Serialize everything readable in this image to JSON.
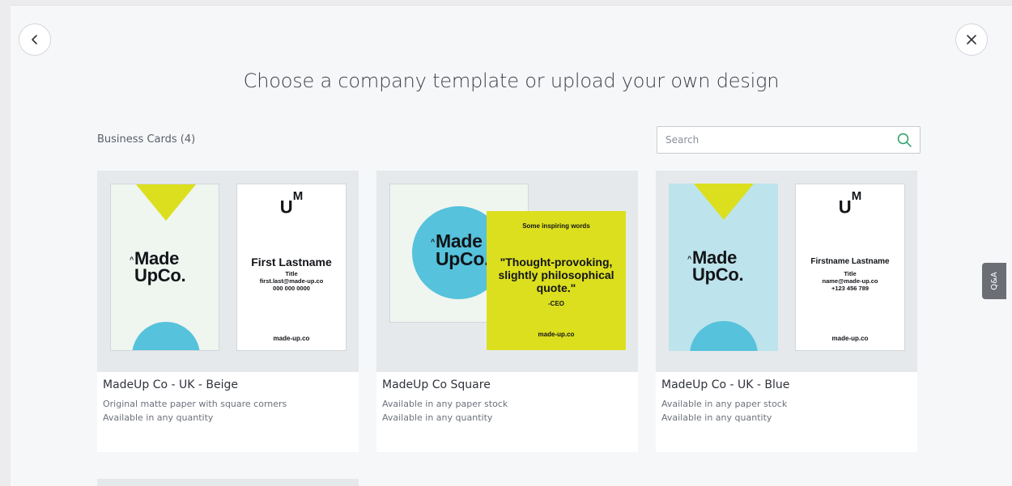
{
  "header": {
    "title": "Choose a company template or upload your own design",
    "back_icon": "chevron-left-icon",
    "close_icon": "close-icon"
  },
  "section": {
    "label": "Business Cards (4)"
  },
  "search": {
    "placeholder": "Search",
    "value": "",
    "icon": "search-icon"
  },
  "templates": [
    {
      "name": "MadeUp Co - UK - Beige",
      "line1": "Original matte paper with square corners",
      "line2": "Available in any quantity",
      "preview": {
        "logo": [
          "Made",
          "UpCo."
        ],
        "um": [
          "U",
          "M"
        ],
        "person": "First Lastname",
        "details": [
          "Title",
          "first.last@made-up.co",
          "000 000 0000"
        ],
        "url": "made-up.co",
        "front_color": "#eff5ef"
      }
    },
    {
      "name": "MadeUp Co Square",
      "line1": "Available in any paper stock",
      "line2": "Available in any quantity",
      "preview": {
        "logo": [
          "Made",
          "UpCo."
        ],
        "small": "Some inspiring words",
        "quote": "\"Thought-provoking, slightly philosophical quote.\"",
        "attribution": "-CEO",
        "url": "made-up.co"
      }
    },
    {
      "name": "MadeUp Co - UK - Blue",
      "line1": "Available in any paper stock",
      "line2": "Available in any quantity",
      "preview": {
        "logo": [
          "Made",
          "UpCo."
        ],
        "um": [
          "U",
          "M"
        ],
        "person": "Firstname Lastname",
        "details": [
          "Title",
          "name@made-up.co",
          "+123 456 789"
        ],
        "url": "made-up.co",
        "front_color": "#bde3ec"
      }
    }
  ],
  "qa_tab": {
    "label": "Q&A"
  },
  "colors": {
    "accent_yellow": "#dcdf1e",
    "accent_blue": "#56c2dc",
    "search_icon": "#2a9d6b"
  }
}
